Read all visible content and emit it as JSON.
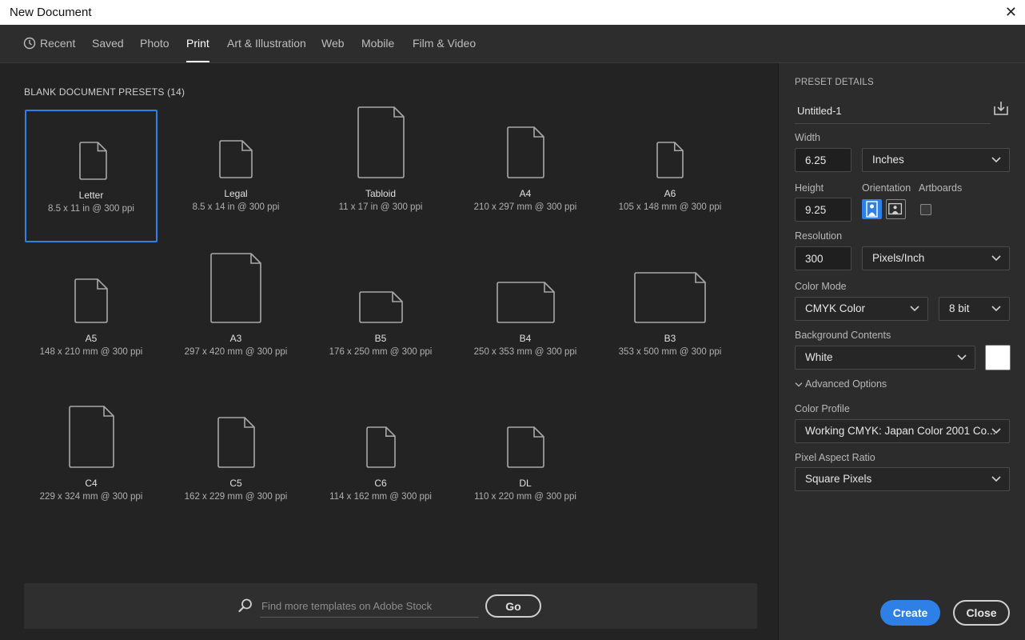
{
  "window": {
    "title": "New Document",
    "close_glyph": "✕"
  },
  "tabs": [
    {
      "label": "Recent",
      "icon": "clock-icon"
    },
    {
      "label": "Saved"
    },
    {
      "label": "Photo"
    },
    {
      "label": "Print",
      "active": true
    },
    {
      "label": "Art & Illustration"
    },
    {
      "label": "Web"
    },
    {
      "label": "Mobile"
    },
    {
      "label": "Film & Video"
    }
  ],
  "presets": {
    "heading": "BLANK DOCUMENT PRESETS",
    "count": "(14)",
    "items": [
      {
        "name": "Letter",
        "dims": "8.5 x 11 in @ 300 ppi",
        "selected": true
      },
      {
        "name": "Legal",
        "dims": "8.5 x 14 in @ 300 ppi"
      },
      {
        "name": "Tabloid",
        "dims": "11 x 17 in @ 300 ppi"
      },
      {
        "name": "A4",
        "dims": "210 x 297 mm @ 300 ppi"
      },
      {
        "name": "A6",
        "dims": "105 x 148 mm @ 300 ppi"
      },
      {
        "name": "A5",
        "dims": "148 x 210 mm @ 300 ppi"
      },
      {
        "name": "A3",
        "dims": "297 x 420 mm @ 300 ppi"
      },
      {
        "name": "B5",
        "dims": "176 x 250 mm @ 300 ppi"
      },
      {
        "name": "B4",
        "dims": "250 x 353 mm @ 300 ppi"
      },
      {
        "name": "B3",
        "dims": "353 x 500 mm @ 300 ppi"
      },
      {
        "name": "C4",
        "dims": "229 x 324 mm @ 300 ppi"
      },
      {
        "name": "C5",
        "dims": "162 x 229 mm @ 300 ppi"
      },
      {
        "name": "C6",
        "dims": "114 x 162 mm @ 300 ppi"
      },
      {
        "name": "DL",
        "dims": "110 x 220 mm @ 300 ppi"
      }
    ]
  },
  "search": {
    "placeholder": "Find more templates on Adobe Stock",
    "go_label": "Go"
  },
  "details": {
    "title": "PRESET DETAILS",
    "doc_name": "Untitled-1",
    "width_label": "Width",
    "width_value": "6.25",
    "width_unit": "Inches",
    "height_label": "Height",
    "height_value": "9.25",
    "orientation_label": "Orientation",
    "artboards_label": "Artboards",
    "orientation": "portrait",
    "artboards_checked": false,
    "resolution_label": "Resolution",
    "resolution_value": "300",
    "resolution_unit": "Pixels/Inch",
    "color_mode_label": "Color Mode",
    "color_mode": "CMYK Color",
    "bit_depth": "8 bit",
    "bg_label": "Background Contents",
    "bg_value": "White",
    "bg_swatch": "#ffffff",
    "advanced_label": "Advanced Options",
    "profile_label": "Color Profile",
    "profile_value": "Working CMYK: Japan Color 2001 Co...",
    "par_label": "Pixel Aspect Ratio",
    "par_value": "Square Pixels"
  },
  "actions": {
    "create_label": "Create",
    "close_label": "Close"
  },
  "colors": {
    "accent": "#2e80e6",
    "panel_bg": "#2c2c2c",
    "main_bg": "#232323"
  }
}
